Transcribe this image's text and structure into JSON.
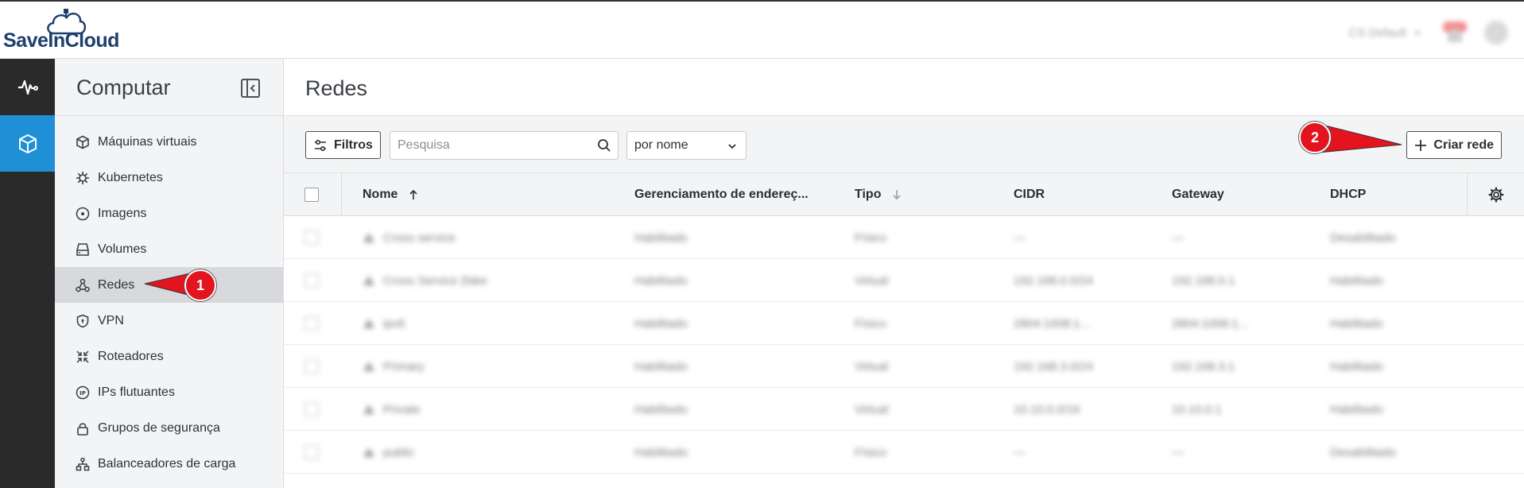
{
  "brand": {
    "logo_text": "SaveInCloud"
  },
  "topbar": {
    "project": "CS Default"
  },
  "sidebar": {
    "title": "Computar",
    "items": [
      {
        "label": "Máquinas virtuais",
        "icon": "cube-outline-icon"
      },
      {
        "label": "Kubernetes",
        "icon": "helm-icon"
      },
      {
        "label": "Imagens",
        "icon": "disc-icon"
      },
      {
        "label": "Volumes",
        "icon": "hard-drive-icon"
      },
      {
        "label": "Redes",
        "icon": "network-icon"
      },
      {
        "label": "VPN",
        "icon": "shield-icon"
      },
      {
        "label": "Roteadores",
        "icon": "router-icon"
      },
      {
        "label": "IPs flutuantes",
        "icon": "ip-icon"
      },
      {
        "label": "Grupos de segurança",
        "icon": "lock-icon"
      },
      {
        "label": "Balanceadores de carga",
        "icon": "balance-icon"
      }
    ],
    "active_item": "Redes"
  },
  "main": {
    "title": "Redes",
    "toolbar": {
      "filters_label": "Filtros",
      "search_placeholder": "Pesquisa",
      "sort_value": "por nome",
      "create_label": "Criar rede"
    },
    "table": {
      "columns": [
        "Nome",
        "Gerenciamento de endereç...",
        "Tipo",
        "CIDR",
        "Gateway",
        "DHCP"
      ],
      "rows": [
        [
          "Cross service",
          "Habilitado",
          "Físico",
          "—",
          "—",
          "Desabilitado"
        ],
        [
          "Cross Service (fake",
          "Habilitado",
          "Virtual",
          "192.168.0.0/24",
          "192.168.0.1",
          "Habilitado"
        ],
        [
          "ipv6",
          "Habilitado",
          "Físico",
          "2804:1008:1...",
          "2804:1008:1...",
          "Habilitado"
        ],
        [
          "Primary",
          "Habilitado",
          "Virtual",
          "192.168.3.0/24",
          "192.168.3.1",
          "Habilitado"
        ],
        [
          "Private",
          "Habilitado",
          "Virtual",
          "10.10.0.0/16",
          "10.10.0.1",
          "Habilitado"
        ],
        [
          "public",
          "Habilitado",
          "Físico",
          "—",
          "—",
          "Desabilitado"
        ]
      ]
    }
  },
  "annotations": {
    "step1": "1",
    "step2": "2",
    "color": "#e3141e"
  }
}
